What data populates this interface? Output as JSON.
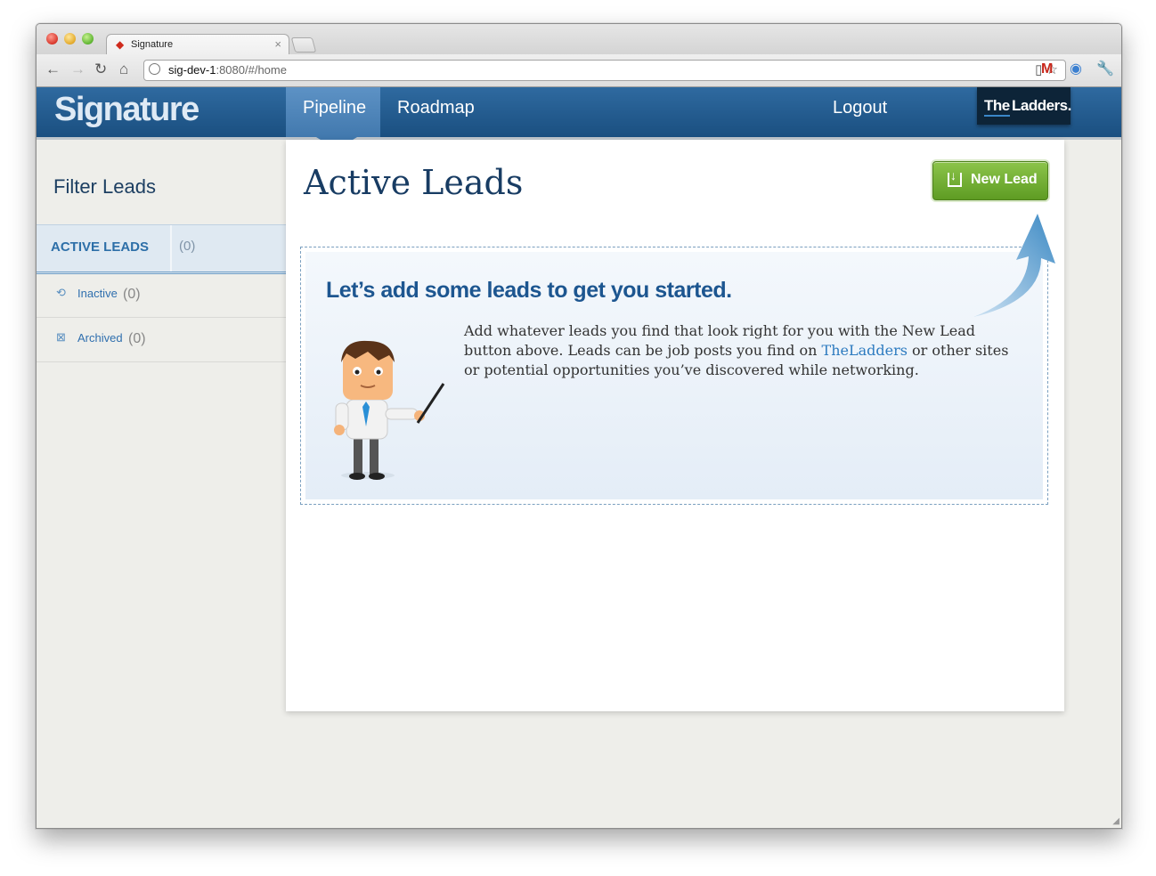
{
  "browser": {
    "tab_title": "Signature",
    "tab_close": "×",
    "favicon": "superman-s-icon",
    "url_host": "sig-dev-1",
    "url_rest": ":8080/#/home"
  },
  "app": {
    "logo": "Signature",
    "nav": {
      "pipeline": "Pipeline",
      "roadmap": "Roadmap",
      "logout": "Logout"
    },
    "brand": {
      "the": "The",
      "ladders": "Ladders."
    }
  },
  "sidebar": {
    "title": "Filter Leads",
    "active": {
      "label": "ACTIVE LEADS",
      "count": "(0)"
    },
    "items": [
      {
        "label": "Inactive",
        "count": "(0)",
        "icon": "inactive-icon"
      },
      {
        "label": "Archived",
        "count": "(0)",
        "icon": "archive-icon"
      }
    ]
  },
  "main": {
    "title": "Active Leads",
    "new_lead_button": "New Lead",
    "empty_state": {
      "heading": "Let’s add some leads to get you started.",
      "text_before": "Add whatever leads you find that look right for you with the New Lead button above. Leads can be job posts you find on ",
      "link": "TheLadders",
      "text_after": " or other sites or potential opportunities you’ve discovered while networking."
    }
  },
  "colors": {
    "appbar": "#1a4f80",
    "nav_active": "#4279ae",
    "button_green": "#5e9c23",
    "title_blue": "#183c63"
  }
}
